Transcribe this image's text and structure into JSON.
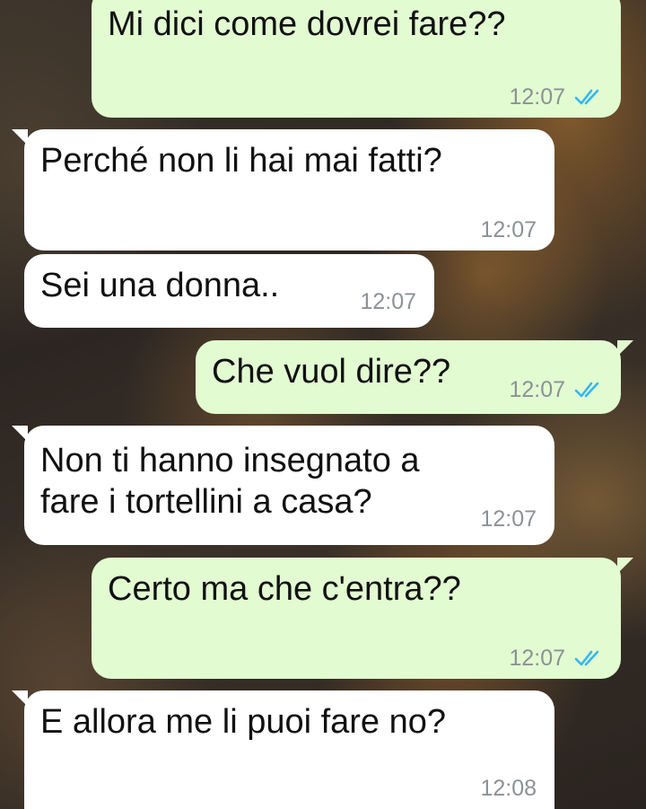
{
  "messages": [
    {
      "direction": "outgoing",
      "text": "Mi dici come dovrei fare??",
      "time": "12:07",
      "status": "read"
    },
    {
      "direction": "incoming",
      "text": "Perché non li hai mai fatti?",
      "time": "12:07"
    },
    {
      "direction": "incoming",
      "text": "Sei una donna..",
      "time": "12:07"
    },
    {
      "direction": "outgoing",
      "text": "Che vuol dire??",
      "time": "12:07",
      "status": "read"
    },
    {
      "direction": "incoming",
      "text_line1": "Non ti hanno insegnato a",
      "text_line2": "fare i tortellini a casa?",
      "time": "12:07"
    },
    {
      "direction": "outgoing",
      "text": "Certo ma che c'entra??",
      "time": "12:07",
      "status": "read"
    },
    {
      "direction": "incoming",
      "text": "E allora me li puoi fare no?",
      "time": "12:08"
    }
  ],
  "colors": {
    "outgoing_bubble": "#e2fbd1",
    "incoming_bubble": "#ffffff",
    "timestamp": "#8c9296",
    "read_ticks": "#34b7f1"
  },
  "icons": {
    "read_receipt": "double-check-icon"
  }
}
